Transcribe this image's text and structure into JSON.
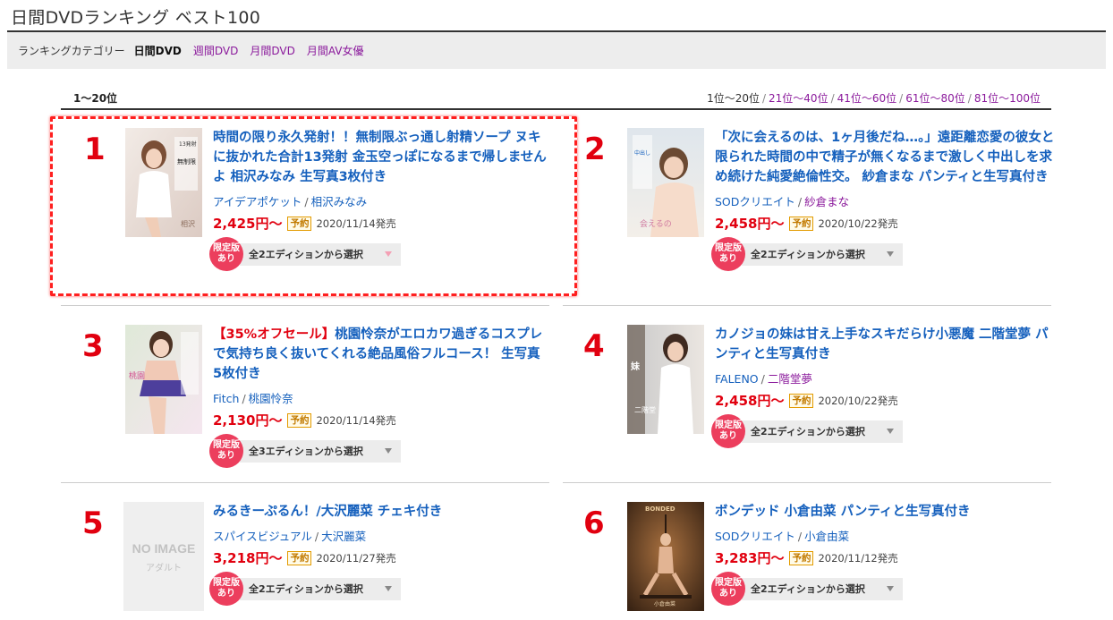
{
  "header": {
    "title": "日間DVDランキング ベスト100"
  },
  "category_bar": {
    "label": "ランキングカテゴリー",
    "current": "日間DVD",
    "links": [
      "週間DVD",
      "月間DVD",
      "月間AV女優"
    ]
  },
  "range": {
    "current": "1〜20位",
    "pager_current": "1位〜20位",
    "pager_links": [
      "21位〜40位",
      "41位〜60位",
      "61位〜80位",
      "81位〜100位"
    ]
  },
  "colors": {
    "accent_red": "#e1000f",
    "link_blue": "#1560bd",
    "link_purple": "#8b1a9c",
    "badge_pink": "#ec3e5d",
    "highlight": "#ff1f1f"
  },
  "items": [
    {
      "rank": "1",
      "title_sale": "",
      "title": "時間の限り永久発射！！無制限ぶっ通し射精ソープ ヌキに抜かれた合計13発射 金玉空っぽになるまで帰しませんよ 相沢みなみ 生写真3枚付き",
      "maker": "アイデアポケット",
      "actress": "相沢みなみ",
      "price": "2,425円〜",
      "yoyaku": "予約",
      "date": "2020/11/14発売",
      "badge": [
        "限定版",
        "あり"
      ],
      "edition": "全2エディションから選択",
      "image": "cover-photo"
    },
    {
      "rank": "2",
      "title_sale": "",
      "title": "「次に会えるのは、1ヶ月後だね…。」遠距離恋愛の彼女と限られた時間の中で精子が無くなるまで激しく中出しを求め続けた純愛絶倫性交。 紗倉まな パンティと生写真付き",
      "maker": "SODクリエイト",
      "actress": "紗倉まな",
      "price": "2,458円〜",
      "yoyaku": "予約",
      "date": "2020/10/22発売",
      "badge": [
        "限定版",
        "あり"
      ],
      "edition": "全2エディションから選択",
      "image": "cover-photo"
    },
    {
      "rank": "3",
      "title_sale": "【35%オフセール】",
      "title": "桃園怜奈がエロカワ過ぎるコスプレで気持ち良く抜いてくれる絶品風俗フルコース！ 生写真5枚付き",
      "maker": "Fitch",
      "actress": "桃園怜奈",
      "price": "2,130円〜",
      "yoyaku": "予約",
      "date": "2020/11/14発売",
      "badge": [
        "限定版",
        "あり"
      ],
      "edition": "全3エディションから選択",
      "image": "cover-photo"
    },
    {
      "rank": "4",
      "title_sale": "",
      "title": "カノジョの妹は甘え上手なスキだらけ小悪魔 二階堂夢 パンティと生写真付き",
      "maker": "FALENO",
      "actress": "二階堂夢",
      "price": "2,458円〜",
      "yoyaku": "予約",
      "date": "2020/10/22発売",
      "badge": [
        "限定版",
        "あり"
      ],
      "edition": "全2エディションから選択",
      "image": "cover-photo"
    },
    {
      "rank": "5",
      "title_sale": "",
      "title": "みるきーぷるん！/大沢麗菜 チェキ付き",
      "maker": "スパイスビジュアル",
      "actress": "大沢麗菜",
      "price": "3,218円〜",
      "yoyaku": "予約",
      "date": "2020/11/27発売",
      "badge": [
        "限定版",
        "あり"
      ],
      "edition": "全2エディションから選択",
      "image": "no-image",
      "placeholder_text": [
        "NO IMAGE",
        "アダルト"
      ]
    },
    {
      "rank": "6",
      "title_sale": "",
      "title": "ボンデッド 小倉由菜 パンティと生写真付き",
      "maker": "SODクリエイト",
      "actress": "小倉由菜",
      "price": "3,283円〜",
      "yoyaku": "予約",
      "date": "2020/11/12発売",
      "badge": [
        "限定版",
        "あり"
      ],
      "edition": "全2エディションから選択",
      "image": "cover-photo-dark"
    }
  ]
}
